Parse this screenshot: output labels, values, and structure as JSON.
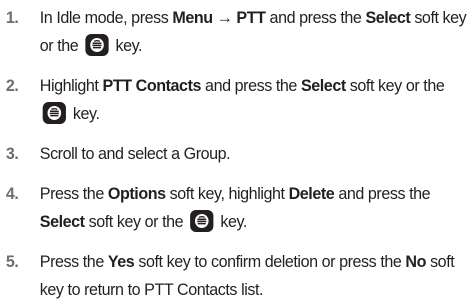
{
  "steps": [
    {
      "number": "1.",
      "parts": [
        "In Idle mode, press ",
        "Menu",
        " → ",
        "PTT",
        " and press the ",
        "Select",
        " soft key or the ",
        " key."
      ],
      "icon": "select-key-icon"
    },
    {
      "number": "2.",
      "parts": [
        "Highlight ",
        "PTT Contacts",
        " and press the ",
        "Select",
        " soft key or the ",
        " key."
      ],
      "icon": "select-key-icon"
    },
    {
      "number": "3.",
      "parts": [
        "Scroll to and select a Group."
      ]
    },
    {
      "number": "4.",
      "parts": [
        "Press the ",
        "Options",
        " soft key, highlight ",
        "Delete",
        " and press the ",
        "Select",
        " soft key or the ",
        " key."
      ],
      "icon": "select-key-icon"
    },
    {
      "number": "5.",
      "parts": [
        "Press the ",
        "Yes",
        " soft key to confirm deletion or press the ",
        "No",
        " soft key to return to PTT Contacts list."
      ]
    }
  ]
}
